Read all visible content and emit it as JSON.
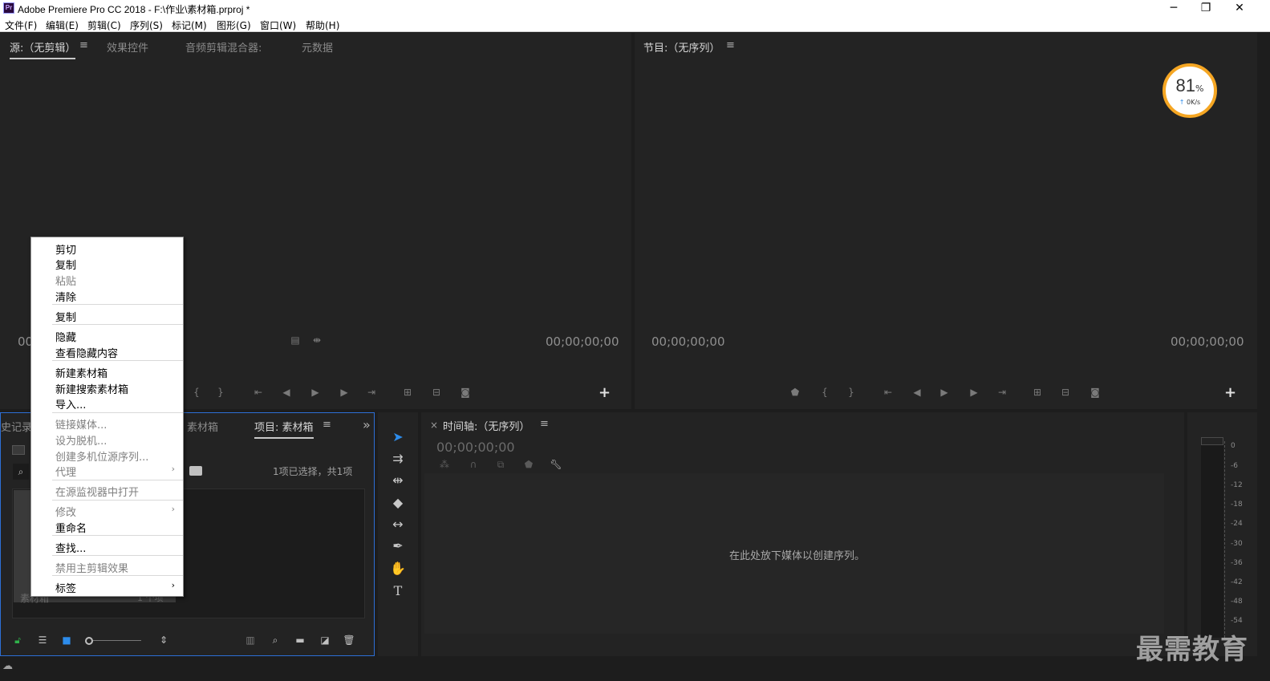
{
  "app": {
    "title": "Adobe Premiere Pro CC 2018 - F:\\作业\\素材箱.prproj *",
    "icon": "Pr"
  },
  "window_controls": {
    "minimize": "─",
    "restore": "❐",
    "close": "✕"
  },
  "menubar": [
    "文件(F)",
    "编辑(E)",
    "剪辑(C)",
    "序列(S)",
    "标记(M)",
    "图形(G)",
    "窗口(W)",
    "帮助(H)"
  ],
  "source_panel": {
    "tabs": [
      "源:（无剪辑）",
      "效果控件",
      "音频剪辑混合器:",
      "元数据"
    ],
    "hamburger": "≡",
    "timecode_left": "00",
    "timecode_right": "00;00;00;00"
  },
  "program_panel": {
    "title": "节目:（无序列）",
    "hamburger": "≡",
    "timecode_left": "00;00;00;00",
    "timecode_right": "00;00;00;00"
  },
  "perf_widget": {
    "percent": "81",
    "unit": "%",
    "rate": "0K/s",
    "ring_color": "#f5a623"
  },
  "project_panel": {
    "tabs": [
      "史记录",
      "素材箱",
      "项目: 素材箱"
    ],
    "hamburger": "≡",
    "overflow": "»",
    "selection_info": "1项已选择，共1项",
    "item_label": "素材箱",
    "item_count": "1 个项"
  },
  "timeline_panel": {
    "close": "×",
    "title": "时间轴:（无序列）",
    "hamburger": "≡",
    "timecode": "00;00;00;00",
    "empty_message": "在此处放下媒体以创建序列。"
  },
  "audio_meter": {
    "labels": [
      "0",
      "-6",
      "-12",
      "-18",
      "-24",
      "-30",
      "-36",
      "-42",
      "-48",
      "-54"
    ]
  },
  "context_menu": {
    "items": [
      {
        "label": "剪切",
        "disabled": false
      },
      {
        "label": "复制",
        "disabled": false
      },
      {
        "label": "粘贴",
        "disabled": true
      },
      {
        "label": "清除",
        "disabled": false
      },
      {
        "label": "复制",
        "disabled": false
      },
      {
        "label": "隐藏",
        "disabled": false
      },
      {
        "label": "查看隐藏内容",
        "disabled": false
      },
      {
        "label": "新建素材箱",
        "disabled": false
      },
      {
        "label": "新建搜索素材箱",
        "disabled": false
      },
      {
        "label": "导入...",
        "disabled": false
      },
      {
        "label": "链接媒体...",
        "disabled": true
      },
      {
        "label": "设为脱机...",
        "disabled": true
      },
      {
        "label": "创建多机位源序列...",
        "disabled": true
      },
      {
        "label": "代理",
        "disabled": true
      },
      {
        "label": "在源监视器中打开",
        "disabled": true
      },
      {
        "label": "修改",
        "disabled": true
      },
      {
        "label": "重命名",
        "disabled": false
      },
      {
        "label": "查找...",
        "disabled": false
      },
      {
        "label": "禁用主剪辑效果",
        "disabled": true
      },
      {
        "label": "标签",
        "disabled": false
      }
    ],
    "submenu_arrow": "›"
  },
  "watermark": "最需教育",
  "colors": {
    "panel_bg": "#232323",
    "border": "#111111",
    "accent_blue": "#2d8ceb",
    "active_frame": "#2d6fd6"
  }
}
